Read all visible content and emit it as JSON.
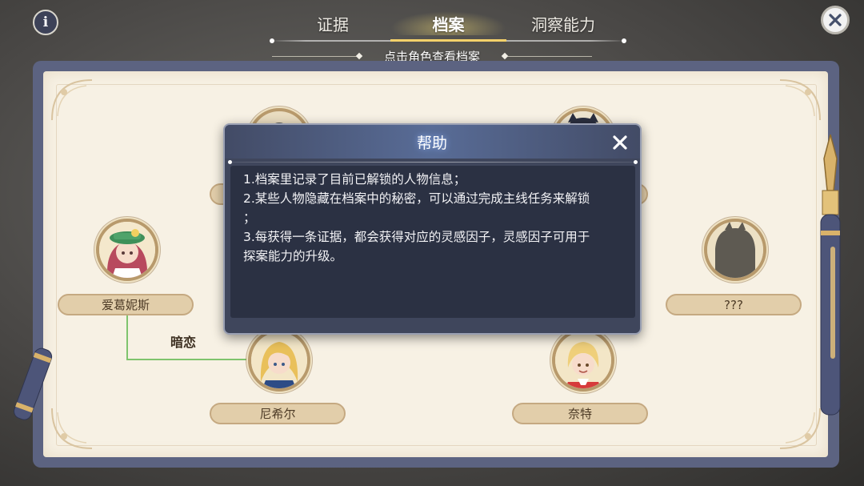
{
  "header": {
    "info_icon": "info-icon",
    "close_icon": "close-icon",
    "tabs": [
      {
        "label": "证据",
        "active": false
      },
      {
        "label": "档案",
        "active": true
      },
      {
        "label": "洞察能力",
        "active": false
      }
    ],
    "subtitle": "点击角色查看档案",
    "accent_color": "#f5d16a"
  },
  "profiles": {
    "top_left": {
      "name": ""
    },
    "top_right": {
      "name": ""
    },
    "center": {
      "name": "???"
    },
    "left": {
      "name": "爱葛妮斯"
    },
    "right": {
      "name": "???"
    },
    "bottom_left": {
      "name": "尼希尔"
    },
    "bottom_right": {
      "name": "奈特"
    },
    "relation": {
      "label": "暗恋",
      "color": "#7fc46d"
    }
  },
  "help_modal": {
    "title": "帮助",
    "close_icon": "close-icon",
    "lines": [
      "1.档案里记录了目前已解锁的人物信息；",
      "2.某些人物隐藏在档案中的秘密，可以通过完成主线任务来解锁",
      "；",
      "3.每获得一条证据，都会获得对应的灵感因子，灵感因子可用于",
      "探案能力的升级。"
    ]
  }
}
